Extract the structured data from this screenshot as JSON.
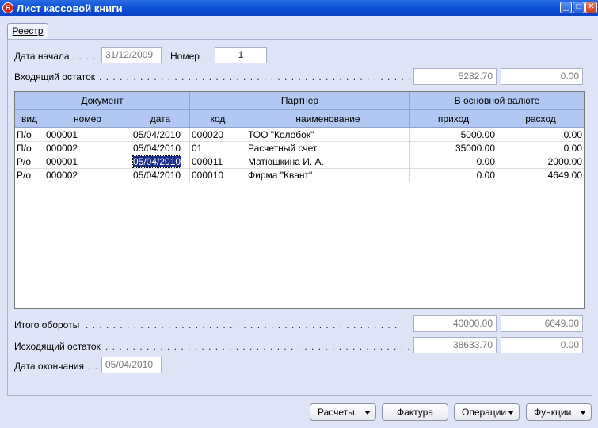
{
  "window": {
    "title": "Лист кассовой книги",
    "app_icon": "Б",
    "controls": [
      "minimize-icon",
      "maximize-icon",
      "close-icon"
    ]
  },
  "tab": {
    "label": "Реестр"
  },
  "form": {
    "start_date_label": "Дата начала",
    "start_date_dots": ". . . . .",
    "start_date_value": "31/12/2009",
    "number_label": "Номер",
    "number_dots": ". .",
    "number_value": "1",
    "opening_balance_label": "Входящий остаток",
    "opening_balance_dots": ". . . . . . . . . . . . . . . . . . . . . . . . . . . . . . . . . . . . . . . . . . . . . . . . . . . . . . . . . . . . . . . . . . . . . . . . . . . . .",
    "opening_balance_income": "5282.70",
    "opening_balance_expense": "0.00"
  },
  "grid": {
    "group_headers": {
      "document": "Документ",
      "partner": "Партнер",
      "currency": "В основной валюте"
    },
    "columns": {
      "kind": "вид",
      "number": "номер",
      "date": "дата",
      "code": "код",
      "name": "наименование",
      "income": "приход",
      "expense": "расход"
    },
    "rows": [
      {
        "kind": "П/о",
        "number": "000001",
        "date": "05/04/2010",
        "code": "000020",
        "name": "ТОО \"Колобок\"",
        "income": "5000.00",
        "expense": "0.00"
      },
      {
        "kind": "П/о",
        "number": "000002",
        "date": "05/04/2010",
        "code": "01",
        "name": "Расчетный счет",
        "income": "35000.00",
        "expense": "0.00"
      },
      {
        "kind": "Р/о",
        "number": "000001",
        "date": "05/04/2010",
        "code": "000011",
        "name": "Матюшкина И. А.",
        "income": "0.00",
        "expense": "2000.00"
      },
      {
        "kind": "Р/о",
        "number": "000002",
        "date": "05/04/2010",
        "code": "000010",
        "name": "Фирма \"Квант\"",
        "income": "0.00",
        "expense": "4649.00"
      }
    ]
  },
  "totals": {
    "turnover_label": "Итого обороты",
    "turnover_dots": ". . . . . . . . . . . . . . . . . . . . . . . . . . . . . . . . . . . . . . . . . . . . . . . . . . . . . . . . . . . . . . . .",
    "turnover_income": "40000.00",
    "turnover_expense": "6649.00",
    "closing_balance_label": "Исходящий остаток",
    "closing_balance_dots": ". . . . . . . . . . . . . . . . . . . . . . . . . . . . . . . . . . . . . . . . . . . . . . . . . . . . . . . . . . . . . .",
    "closing_balance_income": "38633.70",
    "closing_balance_expense": "0.00",
    "end_date_label": "Дата окончания",
    "end_date_dots": ". .",
    "end_date_value": "05/04/2010"
  },
  "buttons": {
    "payments": "Расчеты",
    "invoice": "Фактура",
    "operations": "Операции",
    "functions": "Функции"
  }
}
